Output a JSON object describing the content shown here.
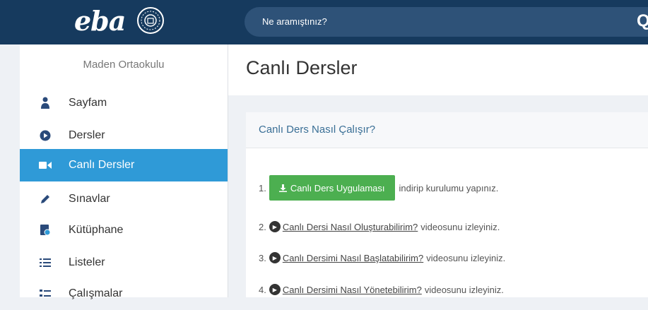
{
  "header": {
    "logo_text": "eba",
    "search_placeholder": "Ne aramıştınız?"
  },
  "sidebar": {
    "school": "Maden Ortaokulu",
    "items": [
      {
        "label": "Sayfam",
        "icon": "user-icon"
      },
      {
        "label": "Dersler",
        "icon": "play-circle-icon"
      },
      {
        "label": "Canlı Dersler",
        "icon": "video-camera-icon"
      },
      {
        "label": "Sınavlar",
        "icon": "pencil-icon"
      },
      {
        "label": "Kütüphane",
        "icon": "library-icon"
      },
      {
        "label": "Listeler",
        "icon": "list-icon"
      },
      {
        "label": "Çalışmalar",
        "icon": "tasks-icon"
      }
    ],
    "active_index": 2
  },
  "main": {
    "title": "Canlı Dersler",
    "card_title": "Canlı Ders Nasıl Çalışır?",
    "steps": [
      {
        "num": "1.",
        "button": "Canlı Ders Uygulaması",
        "text": "indirip kurulumu yapınız."
      },
      {
        "num": "2.",
        "link": "Canlı Dersi Nasıl Oluşturabilirim?",
        "text": "videosunu izleyiniz."
      },
      {
        "num": "3.",
        "link": "Canlı Dersimi Nasıl Başlatabilirim?",
        "text": "videosunu izleyiniz."
      },
      {
        "num": "4.",
        "link": "Canlı Dersimi Nasıl Yönetebilirim?",
        "text": "videosunu izleyiniz."
      }
    ]
  },
  "colors": {
    "topbar": "#163a5e",
    "active": "#2f9ad7",
    "button_green": "#4caf50"
  }
}
